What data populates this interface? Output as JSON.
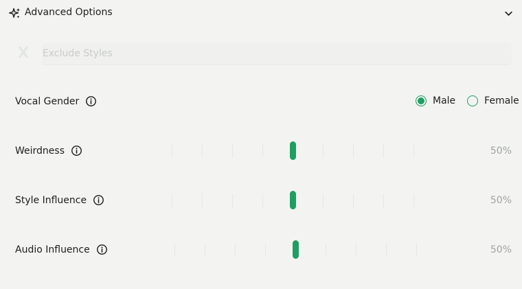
{
  "header": {
    "title": "Advanced Options",
    "icon": "sparkle-icon",
    "chevron": "chevron-down-icon"
  },
  "exclude": {
    "placeholder": "Exclude Styles",
    "icon": "exclude-icon"
  },
  "vocal_gender": {
    "label": "Vocal Gender",
    "options": [
      {
        "label": "Male",
        "selected": true
      },
      {
        "label": "Female",
        "selected": false
      }
    ]
  },
  "sliders": [
    {
      "label": "Weirdness",
      "value_text": "50%",
      "value": 0.5
    },
    {
      "label": "Style Influence",
      "value_text": "50%",
      "value": 0.5
    },
    {
      "label": "Audio Influence",
      "value_text": "50%",
      "value": 0.5
    }
  ],
  "colors": {
    "accent": "#1f9e62",
    "background": "#f3f4f1",
    "muted_text": "#9fa3a0"
  }
}
